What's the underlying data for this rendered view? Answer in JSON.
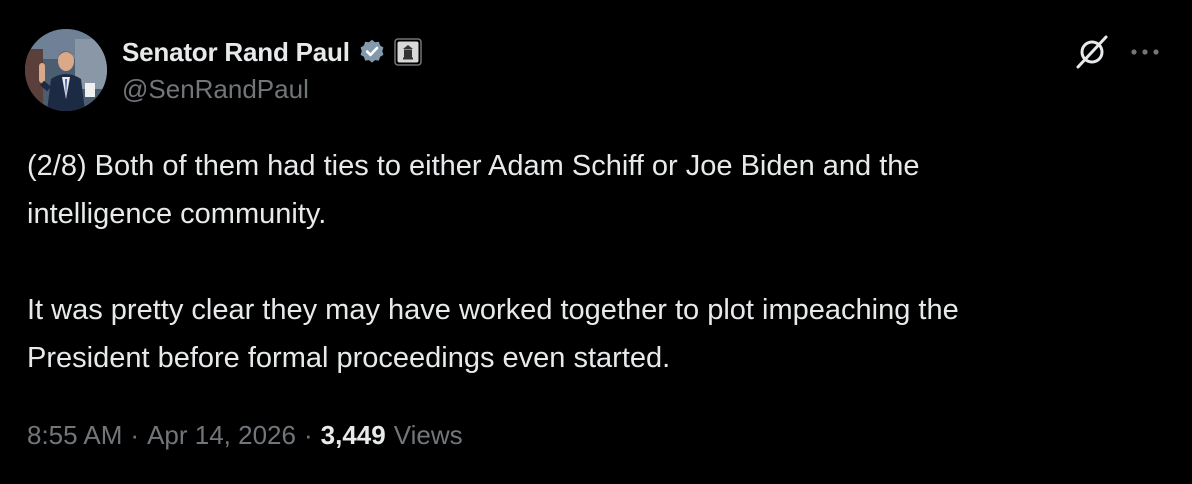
{
  "author": {
    "display_name": "Senator Rand Paul",
    "handle": "@SenRandPaul",
    "verified_badge_color": "#829aab",
    "icons": [
      "avatar",
      "verified-check-icon",
      "government-building-icon"
    ]
  },
  "actions": {
    "icons": [
      "grok-icon",
      "more-options-icon"
    ]
  },
  "tweet": {
    "paragraphs": [
      "(2/8) Both of them had ties to either Adam Schiff or Joe Biden and the\nintelligence community.",
      "It was pretty clear they may have worked together to plot impeaching the\nPresident before formal proceedings even started."
    ]
  },
  "meta": {
    "time": "8:55 AM",
    "separator": "·",
    "date": "Apr 14, 2026",
    "views_count": "3,449",
    "views_label": "Views"
  },
  "colors": {
    "background": "#000000",
    "primary_text": "#e7e9ea",
    "secondary_text": "#71767b"
  }
}
